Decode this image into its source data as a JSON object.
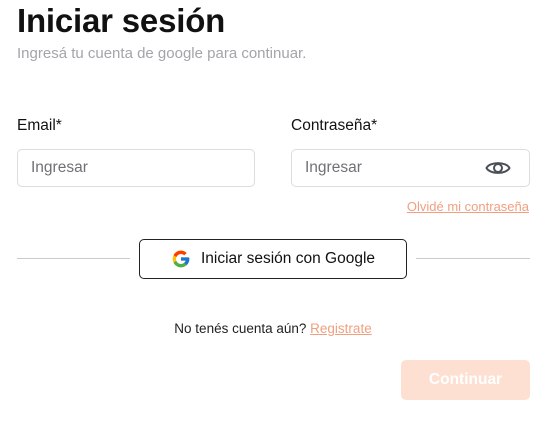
{
  "header": {
    "title": "Iniciar sesión",
    "subtitle": "Ingresá tu cuenta de google para continuar."
  },
  "form": {
    "email": {
      "label": "Email*",
      "value": "",
      "placeholder": "Ingresar"
    },
    "password": {
      "label": "Contraseña*",
      "value": "",
      "placeholder": "Ingresar",
      "toggle_icon": "eye-icon"
    },
    "forgot_password_link": "Olvidé mi contraseña"
  },
  "google_login": {
    "label": "Iniciar sesión con Google",
    "icon": "google-icon"
  },
  "register": {
    "prompt": "No tenés cuenta aún?",
    "link": "Registrate"
  },
  "actions": {
    "continue_label": "Continuar"
  },
  "colors": {
    "accent": "#f0a080",
    "button_disabled_bg": "#fde0d1",
    "subtitle": "#a4a4aa",
    "border": "#dcdce1"
  }
}
